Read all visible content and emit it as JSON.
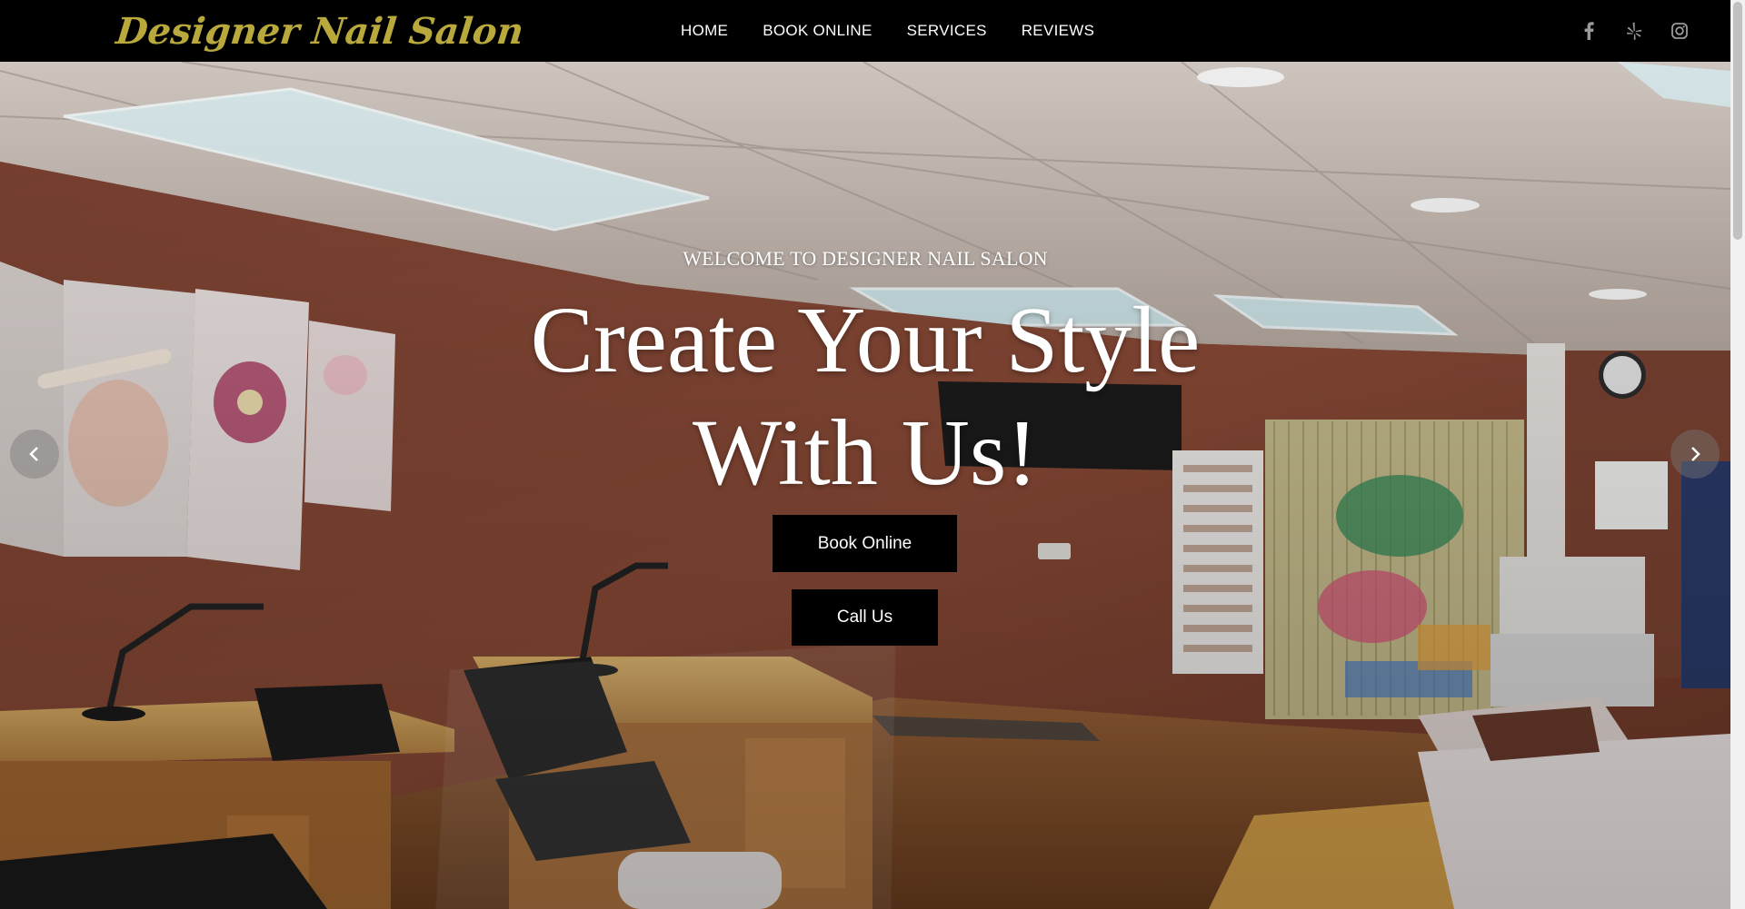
{
  "brand": {
    "logo_text": "Designer Nail Salon",
    "logo_color": "#b9a93c"
  },
  "nav": {
    "items": [
      {
        "label": "HOME"
      },
      {
        "label": "BOOK ONLINE"
      },
      {
        "label": "SERVICES"
      },
      {
        "label": "REVIEWS"
      }
    ]
  },
  "social": {
    "icons": [
      "facebook-icon",
      "yelp-icon",
      "instagram-icon"
    ]
  },
  "hero": {
    "welcome": "WELCOME TO DESIGNER NAIL SALON",
    "headline_line1": "Create Your Style",
    "headline_line2": "With Us!",
    "book_button": "Book Online",
    "call_button": "Call Us",
    "prev_icon": "chevron-left-icon",
    "next_icon": "chevron-right-icon"
  },
  "colors": {
    "header_bg": "#000000",
    "button_bg": "#000000",
    "wall": "#7a3f2c",
    "text": "#ffffff"
  }
}
